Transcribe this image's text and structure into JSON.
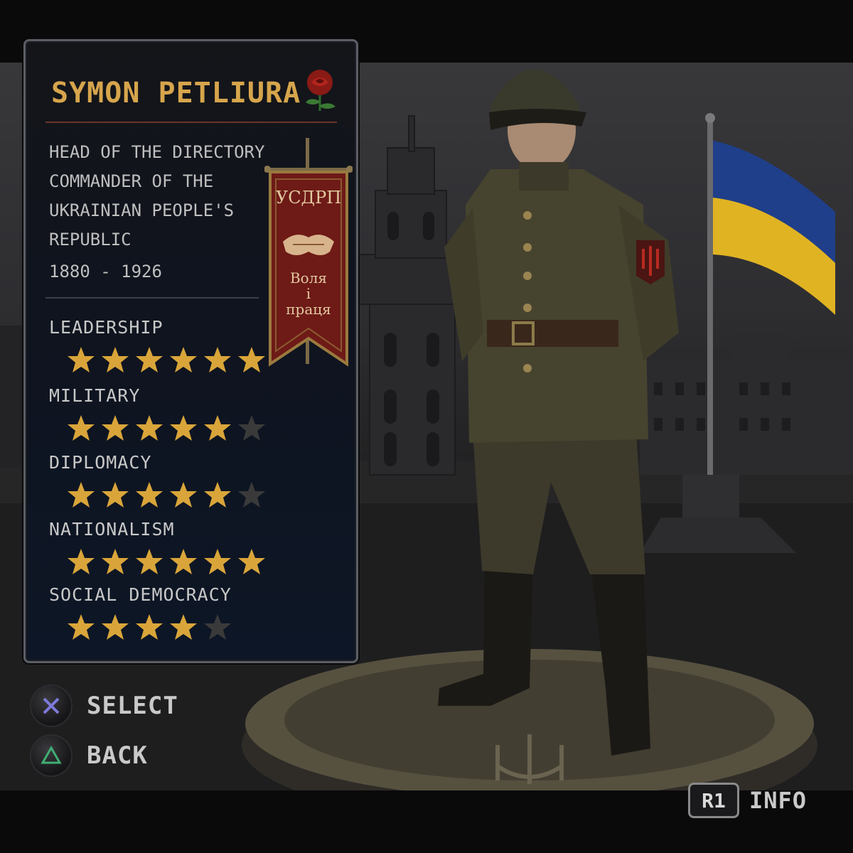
{
  "leader": {
    "name": "SYMON PETLIURA",
    "emblem_icon": "red-rose-icon",
    "description": [
      "HEAD OF THE DIRECTORY",
      "COMMANDER OF THE",
      "UKRAINIAN PEOPLE'S",
      "REPUBLIC"
    ],
    "years": "1880 - 1926"
  },
  "banner": {
    "party": "УСДРП",
    "motto_line1": "Воля",
    "motto_line2": "і",
    "motto_line3": "праця",
    "icon": "handshake-icon"
  },
  "stats": [
    {
      "label": "LEADERSHIP",
      "value": 6,
      "max": 6
    },
    {
      "label": "MILITARY",
      "value": 5,
      "max": 6
    },
    {
      "label": "DIPLOMACY",
      "value": 5,
      "max": 6
    },
    {
      "label": "NATIONALISM",
      "value": 6,
      "max": 6
    },
    {
      "label": "SOCIAL DEMOCRACY",
      "value": 4,
      "max": 5
    }
  ],
  "controls": {
    "select_label": "SELECT",
    "back_label": "BACK",
    "info_key": "R1",
    "info_label": "INFO"
  },
  "colors": {
    "name_gold": "#d6a54c",
    "star_filled": "#d9a53a",
    "star_empty": "#3a3a3a",
    "banner_red": "#6e1a17",
    "flag_blue": "#1f3f8a",
    "flag_yellow": "#e0b323"
  }
}
